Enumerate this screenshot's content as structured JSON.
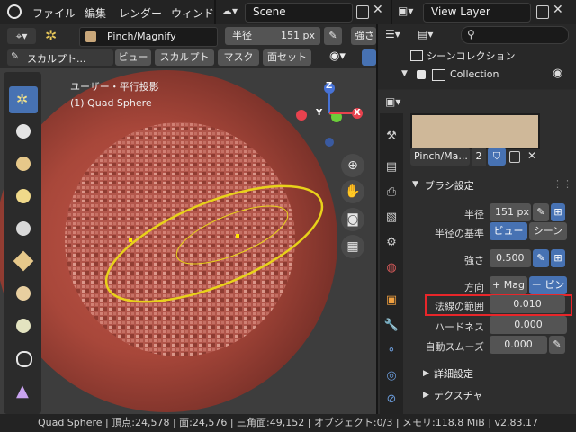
{
  "top_menu": {
    "items": [
      "ファイル",
      "編集",
      "レンダー",
      "ウィンド"
    ],
    "scene": "Scene",
    "view_layer": "View Layer"
  },
  "brush_header": {
    "brush_name": "Pinch/Magnify",
    "radius_label": "半径",
    "radius_value": "151 px",
    "strength_label": "強さ"
  },
  "mode_header": {
    "mode": "スカルプト...",
    "menus": [
      "ビュー",
      "スカルプト",
      "マスク",
      "面セット"
    ]
  },
  "viewport": {
    "view_name": "ユーザー・平行投影",
    "object_name": "(1) Quad Sphere",
    "gizmo_z": "Z",
    "gizmo_y": "Y",
    "gizmo_x": "X"
  },
  "outliner": {
    "title": "シーンコレクション",
    "collection": "Collection"
  },
  "properties": {
    "brush_datablock": "Pinch/Ma...",
    "user_count": "2",
    "panel_title": "ブラシ設定",
    "radius_label": "半径",
    "radius_value": "151 px",
    "radius_unit_label": "半径の基準",
    "radius_unit_options": [
      "ビュー",
      "シーン"
    ],
    "strength_label": "強さ",
    "strength_value": "0.500",
    "direction_label": "方向",
    "direction_options": [
      "+ Mag",
      "ー ピン"
    ],
    "normal_radius_label": "法線の範囲",
    "normal_radius_value": "0.010",
    "hardness_label": "ハードネス",
    "hardness_value": "0.000",
    "autosmooth_label": "自動スムーズ",
    "autosmooth_value": "0.000",
    "subpanels": [
      "詳細設定",
      "テクスチャ"
    ]
  },
  "status_bar": {
    "text": "Quad Sphere | 頂点:24,578 | 面:24,576 | 三角面:49,152 | オブジェクト:0/3 | メモリ:118.8 MiB | v2.83.17"
  },
  "colors": {
    "accent": "#4772b3",
    "highlight_box": "#e8262a",
    "brush_ring": "#e8d21a"
  }
}
